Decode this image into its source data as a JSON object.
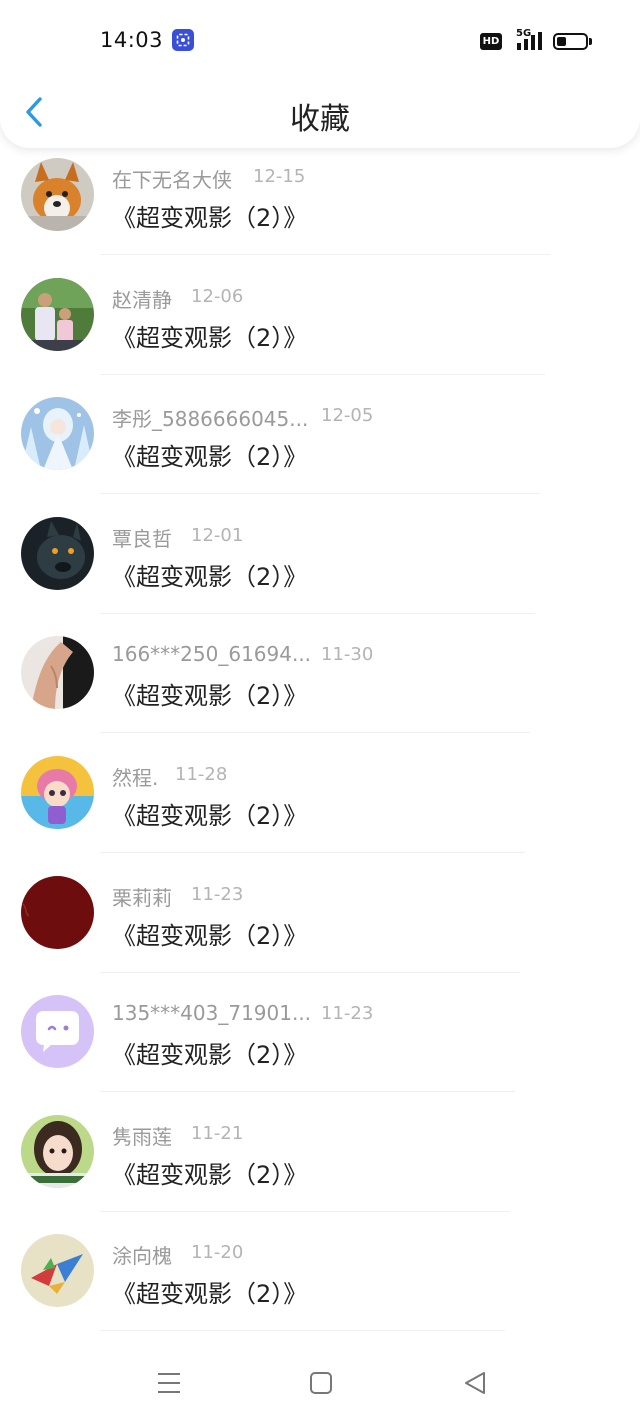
{
  "status_bar": {
    "time": "14:03",
    "network_badge": "HD",
    "network_type": "5G",
    "app_icon": "screen-share-icon",
    "battery_level": 0.35
  },
  "header": {
    "title": "收藏",
    "back_icon": "chevron-left-icon",
    "accent_color": "#2a9ae6"
  },
  "favorites": [
    {
      "name": "在下无名大侠",
      "date": "12-15",
      "title": "《超变观影（2）》",
      "avatar": "corgi-dog-avatar"
    },
    {
      "name": "赵清静",
      "date": "12-06",
      "title": "《超变观影（2）》",
      "avatar": "family-photo-avatar"
    },
    {
      "name": "李彤_5886666045...",
      "date": "12-05",
      "title": "《超变观影（2）》",
      "avatar": "anime-ice-girl-avatar"
    },
    {
      "name": "覃良哲",
      "date": "12-01",
      "title": "《超变观影（2）》",
      "avatar": "dark-wolf-avatar"
    },
    {
      "name": "166***250_61694...",
      "date": "11-30",
      "title": "《超变观影（2）》",
      "avatar": "arm-photo-avatar"
    },
    {
      "name": "然程.",
      "date": "11-28",
      "title": "《超变观影（2）》",
      "avatar": "cartoon-girl-avatar"
    },
    {
      "name": "栗莉莉",
      "date": "11-23",
      "title": "《超变观影（2）》",
      "avatar": "dark-red-avatar"
    },
    {
      "name": "135***403_71901...",
      "date": "11-23",
      "title": "《超变观影（2）》",
      "avatar": "chat-bubble-avatar"
    },
    {
      "name": "隽雨莲",
      "date": "11-21",
      "title": "《超变观影（2）》",
      "avatar": "girl-portrait-avatar"
    },
    {
      "name": "涂向槐",
      "date": "11-20",
      "title": "《超变观影（2）》",
      "avatar": "paper-crane-avatar"
    }
  ],
  "nav_bar": {
    "menu_icon": "menu-icon",
    "home_icon": "home-square-icon",
    "back_icon": "back-triangle-icon"
  }
}
